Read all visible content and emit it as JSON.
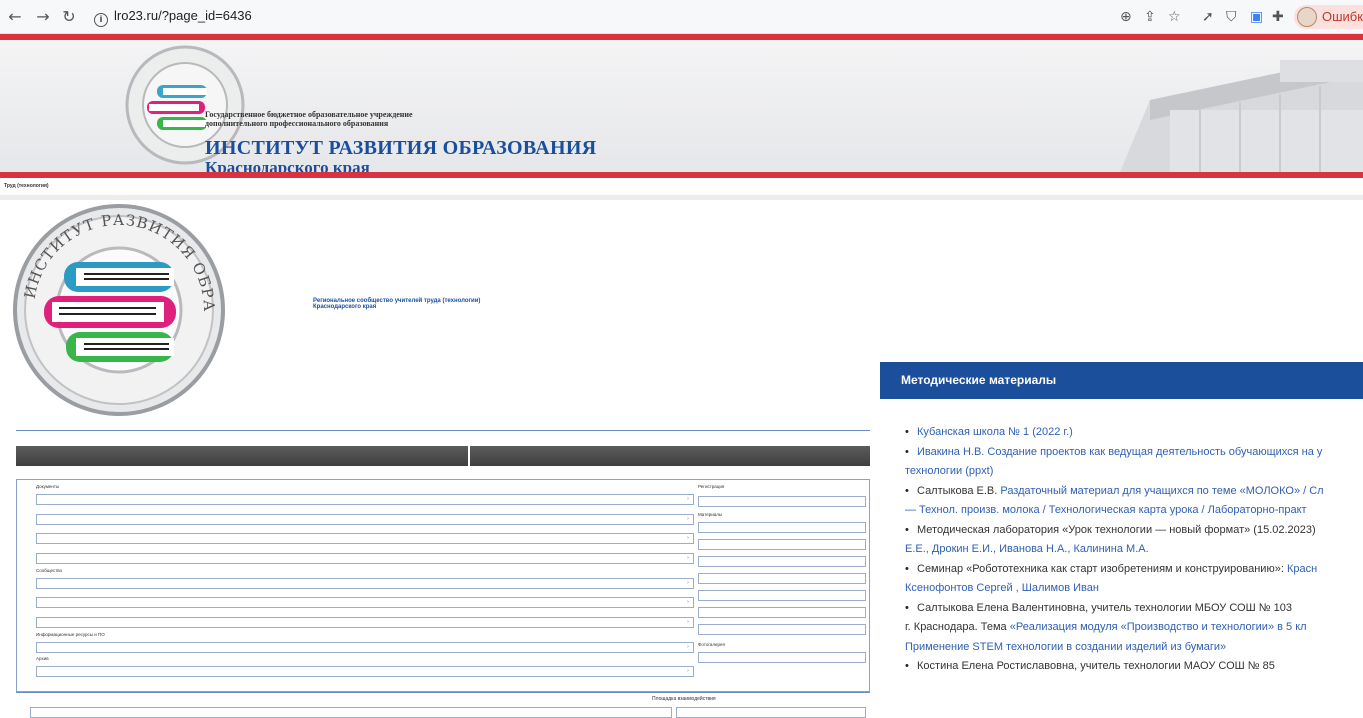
{
  "browser": {
    "url": "lro23.ru/?page_id=6436",
    "error_label": "Ошибка",
    "icons": [
      "back-icon",
      "forward-icon",
      "reload-icon",
      "info-icon",
      "zoom-icon",
      "share-icon",
      "star-icon",
      "rocket-icon",
      "shield-icon",
      "translate-icon",
      "puzzle-icon"
    ]
  },
  "header": {
    "org_line1": "Государственное бюджетное образовательное учреждение",
    "org_line2": "дополнительного профессионального образования",
    "title": "ИНСТИТУТ РАЗВИТИЯ ОБРАЗОВАНИЯ",
    "subtitle": "Краснодарского края",
    "logo_text": "ИНСТИТУТ РАЗВИТИЯ ОБРАЗОВАНИЯ КРАСНОДАРСКОГО КРАЯ",
    "accent": "#d7343f",
    "brand": "#1b4f9c"
  },
  "breadcrumb": "Труд (технология)",
  "community": {
    "title_line1": "Региональное сообщество учителей труда (технологии)",
    "title_line2": "Краснодарского края"
  },
  "metodicheskie": {
    "heading": "Методические материалы",
    "items": [
      [
        {
          "t": "Кубанская школа № 1 (2022 г.)",
          "link": true
        }
      ],
      [
        {
          "t": "Ивакина Н.В. Создание проектов как ведущая деятельность обучающихся на у",
          "link": true
        }
      ],
      [
        {
          "t": "технологии (ppxt)",
          "link": true,
          "cont": true
        }
      ],
      [
        {
          "t": "Салтыкова Е.В. ",
          "link": false
        },
        {
          "t": "Раздаточный материал для учащихся по теме «МОЛОКО» / Сл",
          "link": true
        }
      ],
      [
        {
          "t": "— Технол. произв. молока / Технологическая карта урока / Лабораторно-практ",
          "link": true,
          "cont": true
        }
      ],
      [
        {
          "t": "Методическая лаборатория «Урок технологии — новый формат» (15.02.2023)",
          "link": false
        }
      ],
      [
        {
          "t": "Е.Е., Дрокин Е.И.,  Иванова Н.А., Калинина М.А.",
          "link": true,
          "cont": true
        }
      ],
      [
        {
          "t": "Семинар «Робототехника как старт изобретениям и конструированию»:  ",
          "link": false
        },
        {
          "t": "Красн",
          "link": true
        }
      ],
      [
        {
          "t": "Ксенофонтов Сергей , Шалимов Иван",
          "link": true,
          "cont": true
        }
      ],
      [
        {
          "t": "Салтыкова Елена Валентиновна, учитель технологии МБОУ СОШ № 103",
          "link": false
        }
      ],
      [
        {
          "t": "г. Краснодара. Тема ",
          "link": false,
          "cont": true
        },
        {
          "t": "«Реализация модуля «Производство и технологии» в 5 кл",
          "link": true
        }
      ],
      [
        {
          "t": "Применение STEM технологии в создании изделий из бумаги»",
          "link": true,
          "cont": true
        }
      ],
      [
        {
          "t": "Костина Елена Ростиславовна, учитель технологии МАОУ СОШ  № 85",
          "link": false
        }
      ]
    ]
  },
  "panel": {
    "left_sections": [
      "Документы",
      "Сообщество",
      "Информационные ресурсы и ПО",
      "Архив"
    ],
    "right_sections": [
      "Регистрация",
      "Материалы",
      "Фотогалерея"
    ],
    "bottom_section": "Площадка взаимодействия"
  }
}
